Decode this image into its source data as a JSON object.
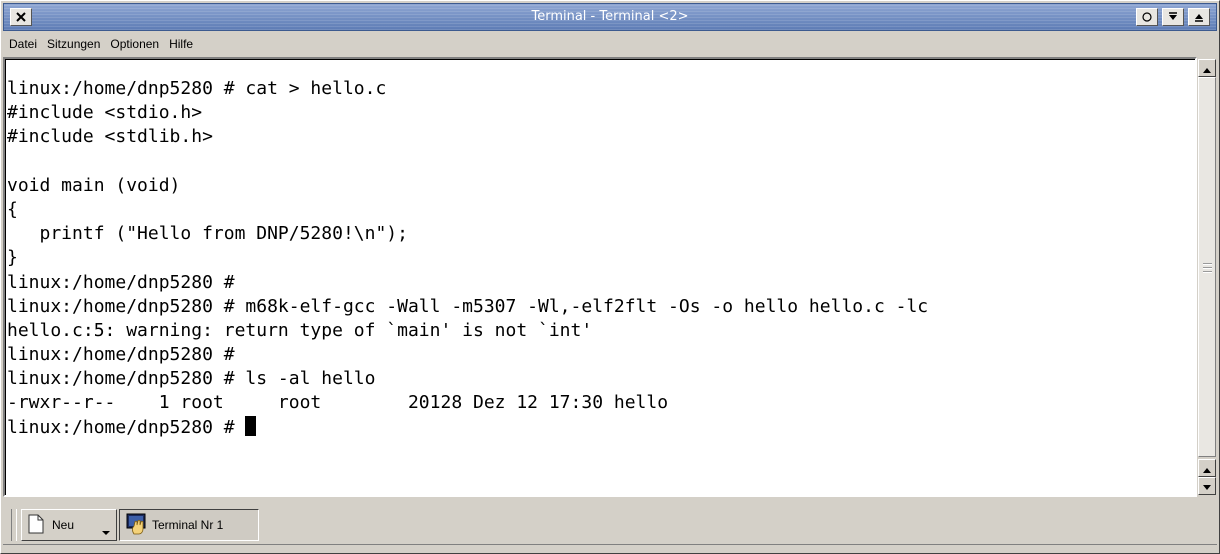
{
  "window": {
    "title": "Terminal - Terminal <2>",
    "title_bar_color": "#6a88bd"
  },
  "menu": [
    "Datei",
    "Sitzungen",
    "Optionen",
    "Hilfe"
  ],
  "terminal": {
    "background": "#ffffff",
    "foreground": "#000000",
    "lines": [
      "linux:/home/dnp5280 # cat > hello.c",
      "#include <stdio.h>",
      "#include <stdlib.h>",
      "",
      "void main (void)",
      "{",
      "   printf (\"Hello from DNP/5280!\\n\");",
      "}",
      "linux:/home/dnp5280 #",
      "linux:/home/dnp5280 # m68k-elf-gcc -Wall -m5307 -Wl,-elf2flt -Os -o hello hello.c -lc",
      "hello.c:5: warning: return type of `main' is not `int'",
      "linux:/home/dnp5280 #",
      "linux:/home/dnp5280 # ls -al hello",
      "-rwxr--r--    1 root     root        20128 Dez 12 17:30 hello"
    ],
    "prompt_line": "linux:/home/dnp5280 # "
  },
  "icons": {
    "close": "close-icon",
    "new_session": "new-document-icon",
    "terminal_session": "terminal-hand-icon",
    "scroll_up": "arrow-up-icon",
    "scroll_down": "arrow-down-icon"
  },
  "tabs": {
    "new_label": "Neu",
    "session_label": "Terminal Nr 1"
  }
}
